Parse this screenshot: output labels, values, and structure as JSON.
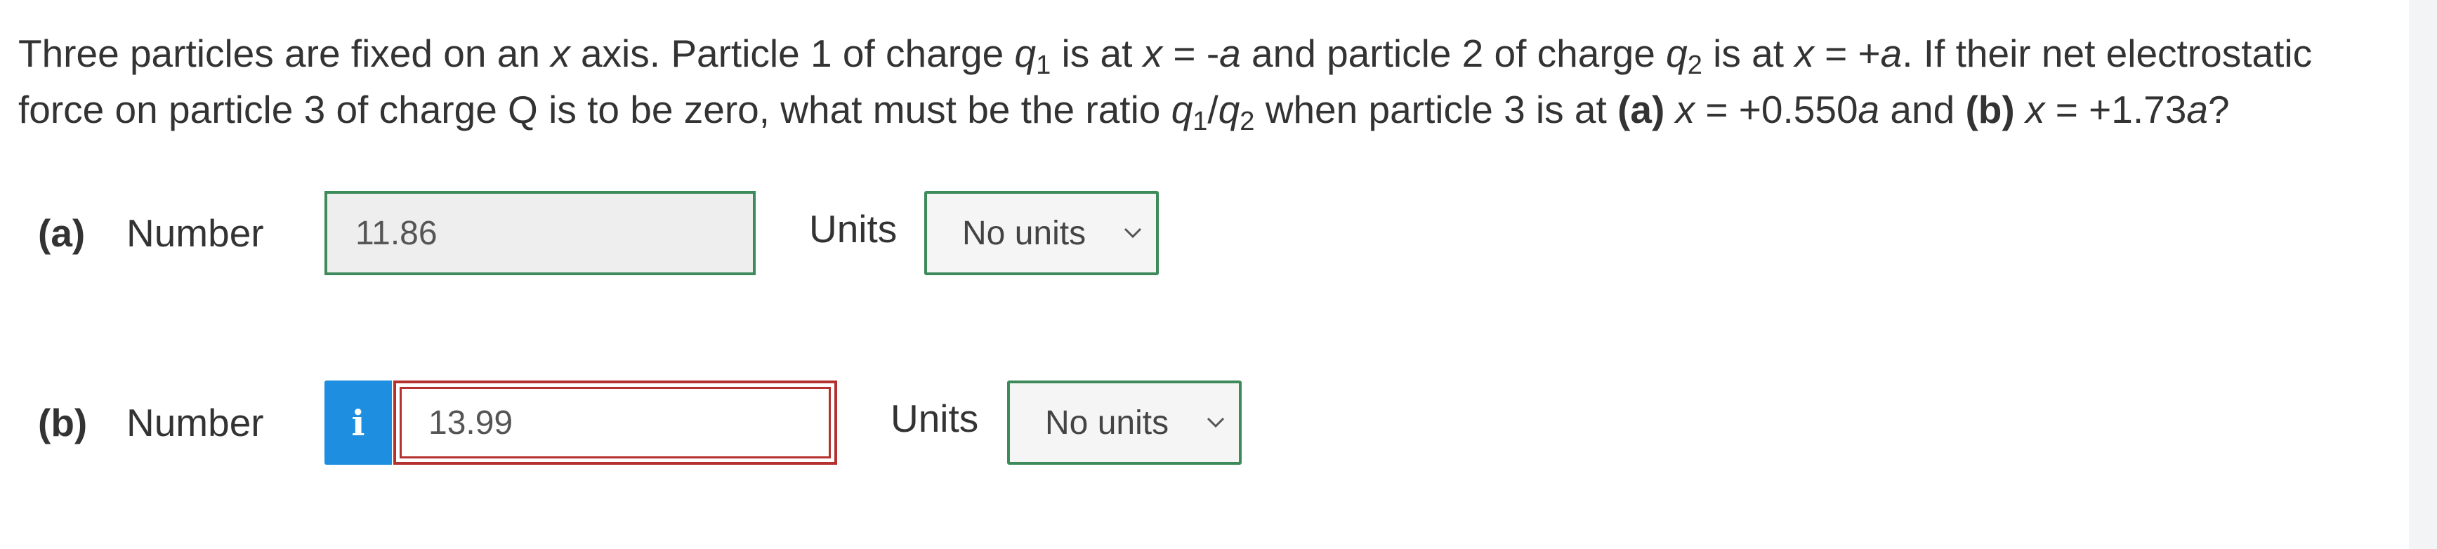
{
  "question": {
    "t1": "Three particles are fixed on an ",
    "v_x": "x",
    "t2": " axis. Particle 1 of charge ",
    "v_q": "q",
    "sub_1": "1",
    "t3": " is at ",
    "v_x2": "x",
    "t4": " = -",
    "v_a": "a",
    "t5": " and particle 2 of charge ",
    "v_q2": "q",
    "sub_2": "2",
    "t6": " is at ",
    "v_x3": "x",
    "t7": " = +",
    "v_a2": "a",
    "t8": ". If their net electrostatic force on particle 3 of charge Q is to be zero, what must be the ratio ",
    "v_q3": "q",
    "sub_3": "1",
    "t9": "/",
    "v_q4": "q",
    "sub_4": "2",
    "t10": " when particle 3 is at ",
    "b_a": "(a)",
    "t11": " ",
    "v_x4": "x",
    "t12": " = +0.550",
    "v_a3": "a",
    "t13": " and ",
    "b_b": "(b)",
    "t14": " ",
    "v_x5": "x",
    "t15": " = +1.73",
    "v_a4": "a",
    "t16": "?"
  },
  "parts": [
    {
      "letter": "(a)",
      "number_label": "Number",
      "answer": "11.86",
      "units_label": "Units",
      "units_value": "No units"
    },
    {
      "letter": "(b)",
      "number_label": "Number",
      "info_icon": "i",
      "answer": "13.99",
      "units_label": "Units",
      "units_value": "No units"
    }
  ],
  "icons": {
    "info": "info-icon",
    "chevron": "chevron-down-icon"
  },
  "colors": {
    "correct_border": "#3d8a5a",
    "incorrect_border": "#b5312f",
    "info_blue": "#1e8ee0"
  }
}
